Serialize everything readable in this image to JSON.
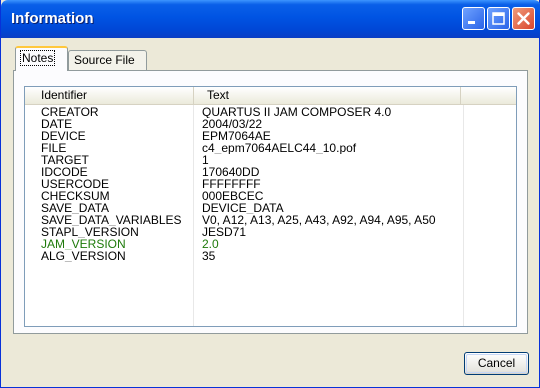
{
  "window": {
    "title": "Information",
    "colors": {
      "titlebar": "#0054e3",
      "close_button": "#d9462c",
      "accent_tab": "#ffc83c",
      "highlight_text": "#1e7a0a"
    }
  },
  "tabs": [
    {
      "label": "Notes",
      "active": true
    },
    {
      "label": "Source File",
      "active": false
    }
  ],
  "table": {
    "columns": [
      "Identifier",
      "Text"
    ],
    "rows": [
      {
        "identifier": "CREATOR",
        "text": "QUARTUS II JAM COMPOSER 4.0"
      },
      {
        "identifier": "DATE",
        "text": "2004/03/22"
      },
      {
        "identifier": "DEVICE",
        "text": "EPM7064AE"
      },
      {
        "identifier": "FILE",
        "text": "c4_epm7064AELC44_10.pof"
      },
      {
        "identifier": "TARGET",
        "text": "1"
      },
      {
        "identifier": "IDCODE",
        "text": "170640DD"
      },
      {
        "identifier": "USERCODE",
        "text": "FFFFFFFF"
      },
      {
        "identifier": "CHECKSUM",
        "text": "000EBCEC"
      },
      {
        "identifier": "SAVE_DATA",
        "text": "DEVICE_DATA"
      },
      {
        "identifier": "SAVE_DATA_VARIABLES",
        "text": "V0, A12, A13, A25, A43, A92, A94, A95, A50"
      },
      {
        "identifier": "STAPL_VERSION",
        "text": "JESD71"
      },
      {
        "identifier": "JAM_VERSION",
        "text": "2.0",
        "highlighted": true
      },
      {
        "identifier": "ALG_VERSION",
        "text": "35"
      }
    ]
  },
  "buttons": {
    "cancel_label": "Cancel"
  },
  "icons": {
    "minimize": "minimize-icon",
    "maximize": "maximize-icon",
    "close": "close-icon"
  }
}
